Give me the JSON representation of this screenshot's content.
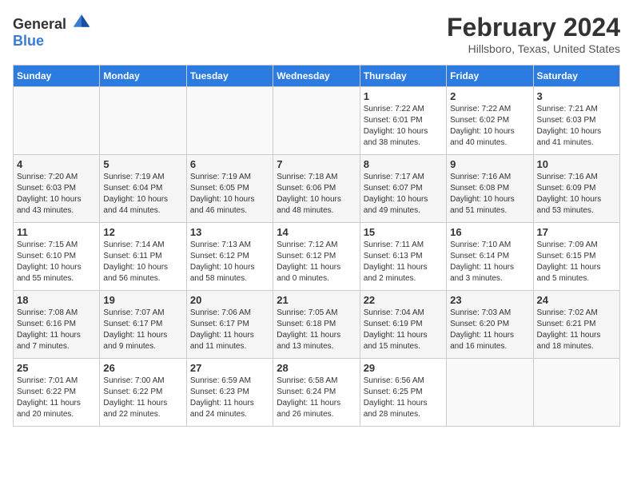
{
  "logo": {
    "general": "General",
    "blue": "Blue"
  },
  "title": {
    "month": "February 2024",
    "location": "Hillsboro, Texas, United States"
  },
  "headers": [
    "Sunday",
    "Monday",
    "Tuesday",
    "Wednesday",
    "Thursday",
    "Friday",
    "Saturday"
  ],
  "weeks": [
    {
      "shaded": false,
      "days": [
        {
          "num": "",
          "info": ""
        },
        {
          "num": "",
          "info": ""
        },
        {
          "num": "",
          "info": ""
        },
        {
          "num": "",
          "info": ""
        },
        {
          "num": "1",
          "info": "Sunrise: 7:22 AM\nSunset: 6:01 PM\nDaylight: 10 hours\nand 38 minutes."
        },
        {
          "num": "2",
          "info": "Sunrise: 7:22 AM\nSunset: 6:02 PM\nDaylight: 10 hours\nand 40 minutes."
        },
        {
          "num": "3",
          "info": "Sunrise: 7:21 AM\nSunset: 6:03 PM\nDaylight: 10 hours\nand 41 minutes."
        }
      ]
    },
    {
      "shaded": true,
      "days": [
        {
          "num": "4",
          "info": "Sunrise: 7:20 AM\nSunset: 6:03 PM\nDaylight: 10 hours\nand 43 minutes."
        },
        {
          "num": "5",
          "info": "Sunrise: 7:19 AM\nSunset: 6:04 PM\nDaylight: 10 hours\nand 44 minutes."
        },
        {
          "num": "6",
          "info": "Sunrise: 7:19 AM\nSunset: 6:05 PM\nDaylight: 10 hours\nand 46 minutes."
        },
        {
          "num": "7",
          "info": "Sunrise: 7:18 AM\nSunset: 6:06 PM\nDaylight: 10 hours\nand 48 minutes."
        },
        {
          "num": "8",
          "info": "Sunrise: 7:17 AM\nSunset: 6:07 PM\nDaylight: 10 hours\nand 49 minutes."
        },
        {
          "num": "9",
          "info": "Sunrise: 7:16 AM\nSunset: 6:08 PM\nDaylight: 10 hours\nand 51 minutes."
        },
        {
          "num": "10",
          "info": "Sunrise: 7:16 AM\nSunset: 6:09 PM\nDaylight: 10 hours\nand 53 minutes."
        }
      ]
    },
    {
      "shaded": false,
      "days": [
        {
          "num": "11",
          "info": "Sunrise: 7:15 AM\nSunset: 6:10 PM\nDaylight: 10 hours\nand 55 minutes."
        },
        {
          "num": "12",
          "info": "Sunrise: 7:14 AM\nSunset: 6:11 PM\nDaylight: 10 hours\nand 56 minutes."
        },
        {
          "num": "13",
          "info": "Sunrise: 7:13 AM\nSunset: 6:12 PM\nDaylight: 10 hours\nand 58 minutes."
        },
        {
          "num": "14",
          "info": "Sunrise: 7:12 AM\nSunset: 6:12 PM\nDaylight: 11 hours\nand 0 minutes."
        },
        {
          "num": "15",
          "info": "Sunrise: 7:11 AM\nSunset: 6:13 PM\nDaylight: 11 hours\nand 2 minutes."
        },
        {
          "num": "16",
          "info": "Sunrise: 7:10 AM\nSunset: 6:14 PM\nDaylight: 11 hours\nand 3 minutes."
        },
        {
          "num": "17",
          "info": "Sunrise: 7:09 AM\nSunset: 6:15 PM\nDaylight: 11 hours\nand 5 minutes."
        }
      ]
    },
    {
      "shaded": true,
      "days": [
        {
          "num": "18",
          "info": "Sunrise: 7:08 AM\nSunset: 6:16 PM\nDaylight: 11 hours\nand 7 minutes."
        },
        {
          "num": "19",
          "info": "Sunrise: 7:07 AM\nSunset: 6:17 PM\nDaylight: 11 hours\nand 9 minutes."
        },
        {
          "num": "20",
          "info": "Sunrise: 7:06 AM\nSunset: 6:17 PM\nDaylight: 11 hours\nand 11 minutes."
        },
        {
          "num": "21",
          "info": "Sunrise: 7:05 AM\nSunset: 6:18 PM\nDaylight: 11 hours\nand 13 minutes."
        },
        {
          "num": "22",
          "info": "Sunrise: 7:04 AM\nSunset: 6:19 PM\nDaylight: 11 hours\nand 15 minutes."
        },
        {
          "num": "23",
          "info": "Sunrise: 7:03 AM\nSunset: 6:20 PM\nDaylight: 11 hours\nand 16 minutes."
        },
        {
          "num": "24",
          "info": "Sunrise: 7:02 AM\nSunset: 6:21 PM\nDaylight: 11 hours\nand 18 minutes."
        }
      ]
    },
    {
      "shaded": false,
      "days": [
        {
          "num": "25",
          "info": "Sunrise: 7:01 AM\nSunset: 6:22 PM\nDaylight: 11 hours\nand 20 minutes."
        },
        {
          "num": "26",
          "info": "Sunrise: 7:00 AM\nSunset: 6:22 PM\nDaylight: 11 hours\nand 22 minutes."
        },
        {
          "num": "27",
          "info": "Sunrise: 6:59 AM\nSunset: 6:23 PM\nDaylight: 11 hours\nand 24 minutes."
        },
        {
          "num": "28",
          "info": "Sunrise: 6:58 AM\nSunset: 6:24 PM\nDaylight: 11 hours\nand 26 minutes."
        },
        {
          "num": "29",
          "info": "Sunrise: 6:56 AM\nSunset: 6:25 PM\nDaylight: 11 hours\nand 28 minutes."
        },
        {
          "num": "",
          "info": ""
        },
        {
          "num": "",
          "info": ""
        }
      ]
    }
  ]
}
